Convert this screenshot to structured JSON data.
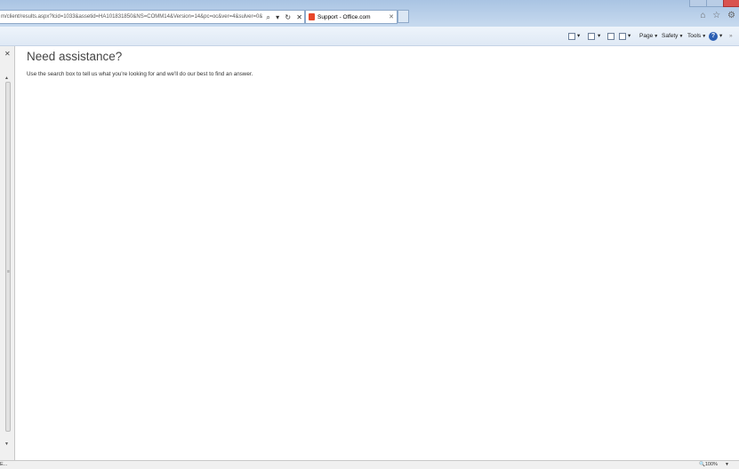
{
  "browser": {
    "address_url": "m/client/results.aspx?lcid=1033&assetid=HA101831850&NS=COMM14&Version=14&pc=oc&ver=4&sulver=0&bf",
    "tab_title": "Support - Office.com",
    "commands": {
      "page": "Page",
      "safety": "Safety",
      "tools": "Tools"
    }
  },
  "content": {
    "title": "Need assistance?",
    "description": "Use the search box to tell us what you're looking for and we'll do our best to find an answer."
  },
  "statusbar": {
    "left_text": "E...",
    "zoom": "100%"
  }
}
